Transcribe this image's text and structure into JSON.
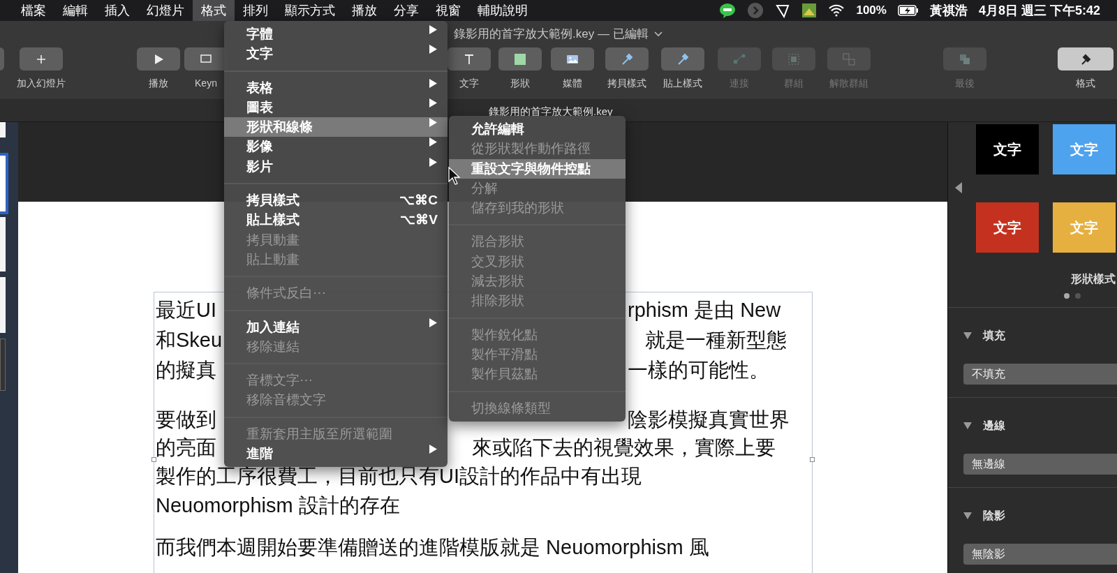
{
  "menubar": {
    "items": [
      {
        "label": "檔案",
        "selected": false
      },
      {
        "label": "編輯",
        "selected": false
      },
      {
        "label": "插入",
        "selected": false
      },
      {
        "label": "幻燈片",
        "selected": false
      },
      {
        "label": "格式",
        "selected": true
      },
      {
        "label": "排列",
        "selected": false
      },
      {
        "label": "顯示方式",
        "selected": false
      },
      {
        "label": "播放",
        "selected": false
      },
      {
        "label": "分享",
        "selected": false
      },
      {
        "label": "視窗",
        "selected": false
      },
      {
        "label": "輔助說明",
        "selected": false
      }
    ],
    "battery": "100%",
    "user": "黃祺浩",
    "clock": "4月8日 週三 下午5:42"
  },
  "window": {
    "title": "錄影用的首字放大範例.key — 已編輯",
    "tab": "錄影用的首字放大範例.key"
  },
  "toolbar": [
    {
      "disabled": false,
      "selected": false
    },
    {
      "label": "加入幻燈片",
      "disabled": false,
      "selected": false
    },
    {
      "label": "播放",
      "disabled": false,
      "selected": false
    },
    {
      "label": "Keyn",
      "disabled": false,
      "selected": false
    },
    {
      "label": "文字",
      "disabled": false,
      "selected": false
    },
    {
      "label": "形狀",
      "disabled": false,
      "selected": false
    },
    {
      "label": "媒體",
      "disabled": false,
      "selected": false
    },
    {
      "label": "拷貝樣式",
      "disabled": false,
      "selected": false
    },
    {
      "label": "貼上樣式",
      "disabled": false,
      "selected": false
    },
    {
      "label": "連接",
      "disabled": true,
      "selected": false
    },
    {
      "label": "群組",
      "disabled": true,
      "selected": false
    },
    {
      "label": "解散群組",
      "disabled": true,
      "selected": false
    },
    {
      "label": "最後",
      "disabled": true,
      "selected": false
    },
    {
      "label": "格式",
      "disabled": false,
      "selected": true
    }
  ],
  "format_menu": [
    {
      "kind": "item",
      "label": "字體",
      "submenu": true,
      "disabled": false,
      "selected": false
    },
    {
      "kind": "item",
      "label": "文字",
      "submenu": true,
      "disabled": false,
      "selected": false
    },
    {
      "kind": "separator"
    },
    {
      "kind": "item",
      "label": "表格",
      "submenu": true,
      "disabled": false,
      "selected": false
    },
    {
      "kind": "item",
      "label": "圖表",
      "submenu": true,
      "disabled": false,
      "selected": false
    },
    {
      "kind": "item",
      "label": "形狀和線條",
      "submenu": true,
      "disabled": false,
      "selected": true
    },
    {
      "kind": "item",
      "label": "影像",
      "submenu": true,
      "disabled": false,
      "selected": false
    },
    {
      "kind": "item",
      "label": "影片",
      "submenu": true,
      "disabled": false,
      "selected": false
    },
    {
      "kind": "separator"
    },
    {
      "kind": "item",
      "label": "拷貝樣式",
      "shortcut": "⌥⌘C",
      "disabled": false,
      "selected": false
    },
    {
      "kind": "item",
      "label": "貼上樣式",
      "shortcut": "⌥⌘V",
      "disabled": false,
      "selected": false
    },
    {
      "kind": "item",
      "label": "拷貝動畫",
      "disabled": true,
      "selected": false
    },
    {
      "kind": "item",
      "label": "貼上動畫",
      "disabled": true,
      "selected": false
    },
    {
      "kind": "separator"
    },
    {
      "kind": "item",
      "label": "條件式反白⋯",
      "disabled": true,
      "selected": false
    },
    {
      "kind": "separator"
    },
    {
      "kind": "item",
      "label": "加入連結",
      "submenu": true,
      "disabled": false,
      "selected": false
    },
    {
      "kind": "item",
      "label": "移除連結",
      "disabled": true,
      "selected": false
    },
    {
      "kind": "separator"
    },
    {
      "kind": "item",
      "label": "音標文字⋯",
      "disabled": true,
      "selected": false
    },
    {
      "kind": "item",
      "label": "移除音標文字",
      "disabled": true,
      "selected": false
    },
    {
      "kind": "separator"
    },
    {
      "kind": "item",
      "label": "重新套用主版至所選範圍",
      "disabled": true,
      "selected": false
    },
    {
      "kind": "item",
      "label": "進階",
      "submenu": true,
      "disabled": false,
      "selected": false
    }
  ],
  "shapes_submenu": [
    {
      "kind": "item",
      "label": "允許編輯",
      "disabled": false,
      "selected": false
    },
    {
      "kind": "item",
      "label": "從形狀製作動作路徑",
      "disabled": true,
      "selected": false
    },
    {
      "kind": "item",
      "label": "重設文字與物件控點",
      "disabled": false,
      "selected": true
    },
    {
      "kind": "item",
      "label": "分解",
      "disabled": true,
      "selected": false
    },
    {
      "kind": "item",
      "label": "儲存到我的形狀",
      "disabled": true,
      "selected": false
    },
    {
      "kind": "separator"
    },
    {
      "kind": "item",
      "label": "混合形狀",
      "disabled": true,
      "selected": false
    },
    {
      "kind": "item",
      "label": "交叉形狀",
      "disabled": true,
      "selected": false
    },
    {
      "kind": "item",
      "label": "減去形狀",
      "disabled": true,
      "selected": false
    },
    {
      "kind": "item",
      "label": "排除形狀",
      "disabled": true,
      "selected": false
    },
    {
      "kind": "separator"
    },
    {
      "kind": "item",
      "label": "製作銳化點",
      "disabled": true,
      "selected": false
    },
    {
      "kind": "item",
      "label": "製作平滑點",
      "disabled": true,
      "selected": false
    },
    {
      "kind": "item",
      "label": "製作貝茲點",
      "disabled": true,
      "selected": false
    },
    {
      "kind": "separator"
    },
    {
      "kind": "item",
      "label": "切換線條類型",
      "disabled": true,
      "selected": false
    }
  ],
  "slide_text": [
    [
      {
        "kind": "split",
        "left": "最近UI",
        "right": "rphism 是由 New"
      },
      {
        "kind": "split",
        "left": "和Skeu",
        "right": "就是一種新型態"
      },
      {
        "kind": "split",
        "left": "的擬真",
        "right": "一樣的可能性。"
      }
    ],
    [
      {
        "kind": "split",
        "left": "要做到",
        "right": "陰影模擬真實世界"
      },
      {
        "kind": "split",
        "left": "的亮面",
        "right": "來或陷下去的視覺效果，實際上要"
      },
      {
        "kind": "whole",
        "text": "製作的工序很費工，目前也只有UI設計的作品中有出現"
      },
      {
        "kind": "whole",
        "text": "Neuomorphism 設計的存在"
      }
    ],
    [
      {
        "kind": "whole",
        "text": "而我們本週開始要準備贈送的進階模版就是 Neuomorphism 風"
      }
    ]
  ],
  "inspector": {
    "styles": [
      {
        "label": "文字",
        "color": "#000000"
      },
      {
        "label": "文字",
        "color": "#4ea3ef"
      },
      {
        "label": "文字",
        "color": "#c4321f"
      },
      {
        "label": "文字",
        "color": "#e6b040"
      }
    ],
    "styles_title": "形狀樣式",
    "pages": [
      {
        "selected": true
      },
      {
        "selected": false
      }
    ],
    "sections": [
      {
        "title": "填充",
        "expanded": true,
        "value": "不填充"
      },
      {
        "title": "邊線",
        "expanded": true,
        "value": "無邊線"
      },
      {
        "title": "陰影",
        "expanded": true,
        "value": "無陰影"
      }
    ]
  }
}
